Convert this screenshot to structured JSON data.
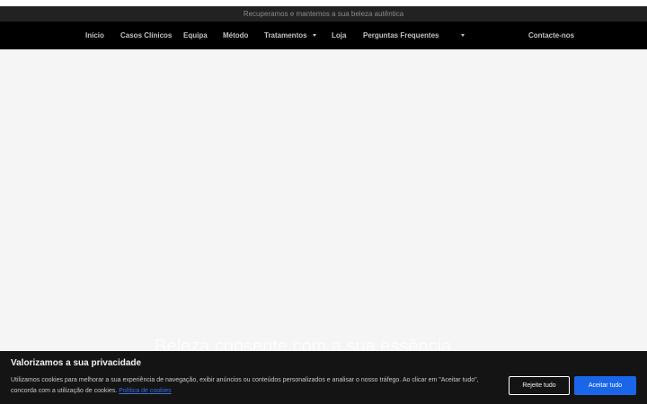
{
  "tagline": "Recuperamos e mantemos a sua beleza autêntica",
  "nav": {
    "items": [
      {
        "label": "Início"
      },
      {
        "label": "Casos Clínicos"
      },
      {
        "label": "Equipa"
      },
      {
        "label": "Método"
      },
      {
        "label": "Tratamentos"
      },
      {
        "label": "Loja"
      },
      {
        "label": "Perguntas Frequentes"
      },
      {
        "label": ""
      },
      {
        "label": "Contacte-nos"
      }
    ]
  },
  "hero": {
    "title": "Beleza consente com a sua essência"
  },
  "cookie": {
    "title": "Valorizamos a sua privacidade",
    "text": "Utilizamos cookies para melhorar a sua experiência de navegação, exibir anúncios ou conteúdos personalizados e analisar o nosso tráfego. Ao clicar em \"Aceitar tudo\", concorda com a utilização de cookies.",
    "link_label": "Política de cookies",
    "reject_label": "Rejeite tudo",
    "accept_label": "Aceitar tudo"
  },
  "colors": {
    "nav_background": "#000000",
    "tagline_background": "#222222",
    "cookie_background": "#141414",
    "accept_button": "#1a66e8",
    "link": "#3b6fe0"
  },
  "icons": {
    "dropdown": "chevron-down-icon"
  }
}
